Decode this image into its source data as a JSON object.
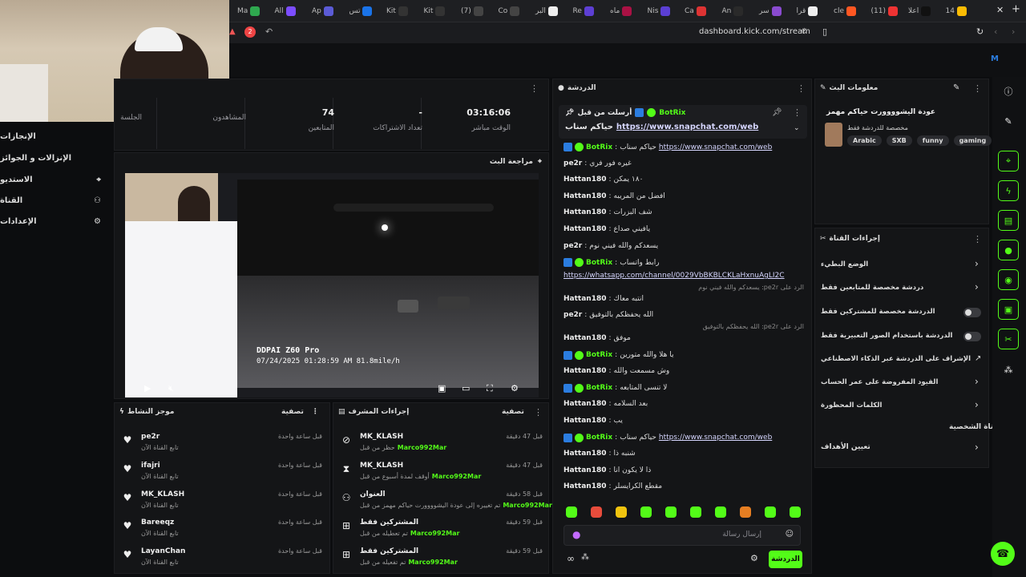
{
  "browser": {
    "tabs": [
      "Ma",
      "All",
      "Ap",
      "تس",
      "Kit",
      "Kit",
      "(7)",
      "Co",
      "البر",
      "Re",
      "ماه",
      "Nis",
      "Ca",
      "An",
      "سر",
      "قرا",
      "cle",
      "(11)",
      "اعلا",
      "14"
    ],
    "url": "dashboard.kick.com/stream",
    "ext_badge": "2"
  },
  "left_nav": [
    {
      "label": "الإنجازات",
      "icon": ""
    },
    {
      "label": "الإنزالات و الجوائز",
      "icon": ""
    },
    {
      "label": "الاستديو",
      "icon": "studio-icon"
    },
    {
      "label": "القناة",
      "icon": "users-icon"
    },
    {
      "label": "الإعدادات",
      "icon": "gear-icon"
    }
  ],
  "stats": [
    {
      "value": "03:16:06",
      "label": "الوقت مباشر"
    },
    {
      "value": "-",
      "label": "تعداد الاشتراكات"
    },
    {
      "value": "74",
      "label": "المتابعين"
    },
    {
      "value": "",
      "label": "المشاهدون"
    },
    {
      "value": "",
      "label": "الجلسة"
    }
  ],
  "preview": {
    "title": "مراجعة البث",
    "overlay_brand": "DDPAI Z60 Pro",
    "overlay_time": "07/24/2025  01:28:59 AM  81.8mile/h"
  },
  "chat": {
    "title": "الدردشة",
    "pinned": {
      "by": "BotRix",
      "label": "أرسلت من قبل",
      "text": "حياكم سناب",
      "link": "https://www.snapchat.com/web"
    },
    "messages": [
      {
        "user": "BotRix",
        "color": "#53fc18",
        "bot": true,
        "text": "حياكم سناب ",
        "link": "https://www.snapchat.com/web"
      },
      {
        "user": "pe2r",
        "color": "#eee",
        "text": "غيره فور فري"
      },
      {
        "user": "Hattan180",
        "color": "#eee",
        "text": "١٨٠ يمكن"
      },
      {
        "user": "Hattan180",
        "color": "#eee",
        "text": "افضل من المريبه"
      },
      {
        "user": "Hattan180",
        "color": "#eee",
        "text": "شف البزرات"
      },
      {
        "user": "Hattan180",
        "color": "#eee",
        "text": "يافيني صداع"
      },
      {
        "user": "pe2r",
        "color": "#eee",
        "text": "يسعدكم والله فيني نوم"
      },
      {
        "user": "BotRix",
        "color": "#53fc18",
        "bot": true,
        "text": "رابط واتساب",
        "link": "https://whatsapp.com/channel/0029VbBKBLCKLaHxnuAgLI2C"
      },
      {
        "user": "Hattan180",
        "color": "#eee",
        "reply": "الرد على pe2r: يسعدكم والله فيني نوم",
        "text": "انتبه معاك"
      },
      {
        "user": "pe2r",
        "color": "#eee",
        "text": "الله يحفظكم بالتوفيق"
      },
      {
        "user": "Hattan180",
        "color": "#eee",
        "reply": "الرد على pe2r: الله يحفظكم بالتوفيق",
        "text": "موفق"
      },
      {
        "user": "BotRix",
        "color": "#53fc18",
        "bot": true,
        "text": "يا هلا والله متورين"
      },
      {
        "user": "Hattan180",
        "color": "#eee",
        "text": "وش مسمعت والله"
      },
      {
        "user": "BotRix",
        "color": "#53fc18",
        "bot": true,
        "text": "لا تنسى المتابعه"
      },
      {
        "user": "Hattan180",
        "color": "#eee",
        "text": "بعد السلامه"
      },
      {
        "user": "Hattan180",
        "color": "#eee",
        "text": "يب"
      },
      {
        "user": "BotRix",
        "color": "#53fc18",
        "bot": true,
        "text": "حياكم سناب ",
        "link": "https://www.snapchat.com/web"
      },
      {
        "user": "Hattan180",
        "color": "#eee",
        "text": "شنبه ذا"
      },
      {
        "user": "Hattan180",
        "color": "#eee",
        "text": "ذا لا يكون انا"
      },
      {
        "user": "Hattan180",
        "color": "#eee",
        "text": "مقطع الكرايسلر"
      }
    ],
    "input_placeholder": "إرسال رسالة",
    "send_label": "الدردشة"
  },
  "stream_info": {
    "title": "معلومات البث",
    "stream_title": "عودة اليشوووورت حياكم مهمز",
    "subtitle": "مخصصة للدردشة فقط",
    "tags": [
      "Arabic",
      "SXB",
      "funny",
      "gaming"
    ]
  },
  "channel_actions": {
    "title": "إجراءات القناة",
    "items": [
      {
        "label": "الوضع البطيء",
        "control": "chevron"
      },
      {
        "label": "دردشة مخصصة للمتابعين فقط",
        "control": "chevron"
      },
      {
        "label": "الدردشة مخصصة للمشتركين فقط",
        "control": "toggle"
      },
      {
        "label": "الدردشة باستخدام الصور التعبيرية فقط",
        "control": "toggle"
      },
      {
        "label": "الإشراف على الدردشة عبر الذكاء الاصطناعي",
        "control": "external"
      },
      {
        "label": "القيود المفروضة على عمر الحساب",
        "control": "chevron"
      },
      {
        "label": "الكلمات المحظورة",
        "control": "chevron"
      }
    ],
    "section": "القناة الشخصية",
    "goals": "تعيين الأهداف"
  },
  "activity": {
    "title": "موجز النشاط",
    "filter": "تصفية",
    "items": [
      {
        "name": "pe2r",
        "sub": "تابع القناة الآن",
        "time": "قبل ساعة واحدة"
      },
      {
        "name": "ifajri",
        "sub": "تابع القناة الآن",
        "time": "قبل ساعة واحدة"
      },
      {
        "name": "MK_KLASH",
        "sub": "تابع القناة الآن",
        "time": "قبل ساعة واحدة"
      },
      {
        "name": "Bareeqz",
        "sub": "تابع القناة الآن",
        "time": "قبل ساعة واحدة"
      },
      {
        "name": "LayanChan",
        "sub": "تابع القناة الآن",
        "time": "قبل ساعة واحدة"
      }
    ]
  },
  "mod": {
    "title": "إجراءات المشرف",
    "filter": "تصفية",
    "items": [
      {
        "name": "MK_KLASH",
        "sub": "حظر من قبل",
        "by": "Marco992Mar",
        "time": "قبل 47 دقيقة",
        "icon": "ban-icon"
      },
      {
        "name": "MK_KLASH",
        "sub": "أوقف لمدة أسبوع من قبل",
        "by": "Marco992Mar",
        "time": "قبل 47 دقيقة",
        "icon": "hourglass-icon"
      },
      {
        "name": "العنوان",
        "sub": "تم تغييره إلى عودة اليشوووورت حياكم مهمز من قبل",
        "by": "Marco992Mar",
        "time": "قبل 58 دقيقة",
        "icon": "title-icon"
      },
      {
        "name": "المشتركين فقط",
        "sub": "تم تعطيله من قبل",
        "by": "Marco992Mar",
        "time": "قبل 59 دقيقة",
        "icon": "gift-icon"
      },
      {
        "name": "المشتركين فقط",
        "sub": "تم تفعيله من قبل",
        "by": "Marco992Mar",
        "time": "قبل 59 دقيقة",
        "icon": "gift-icon"
      }
    ]
  },
  "colors": {
    "kick_green": "#53fc18",
    "panel": "#141517"
  }
}
